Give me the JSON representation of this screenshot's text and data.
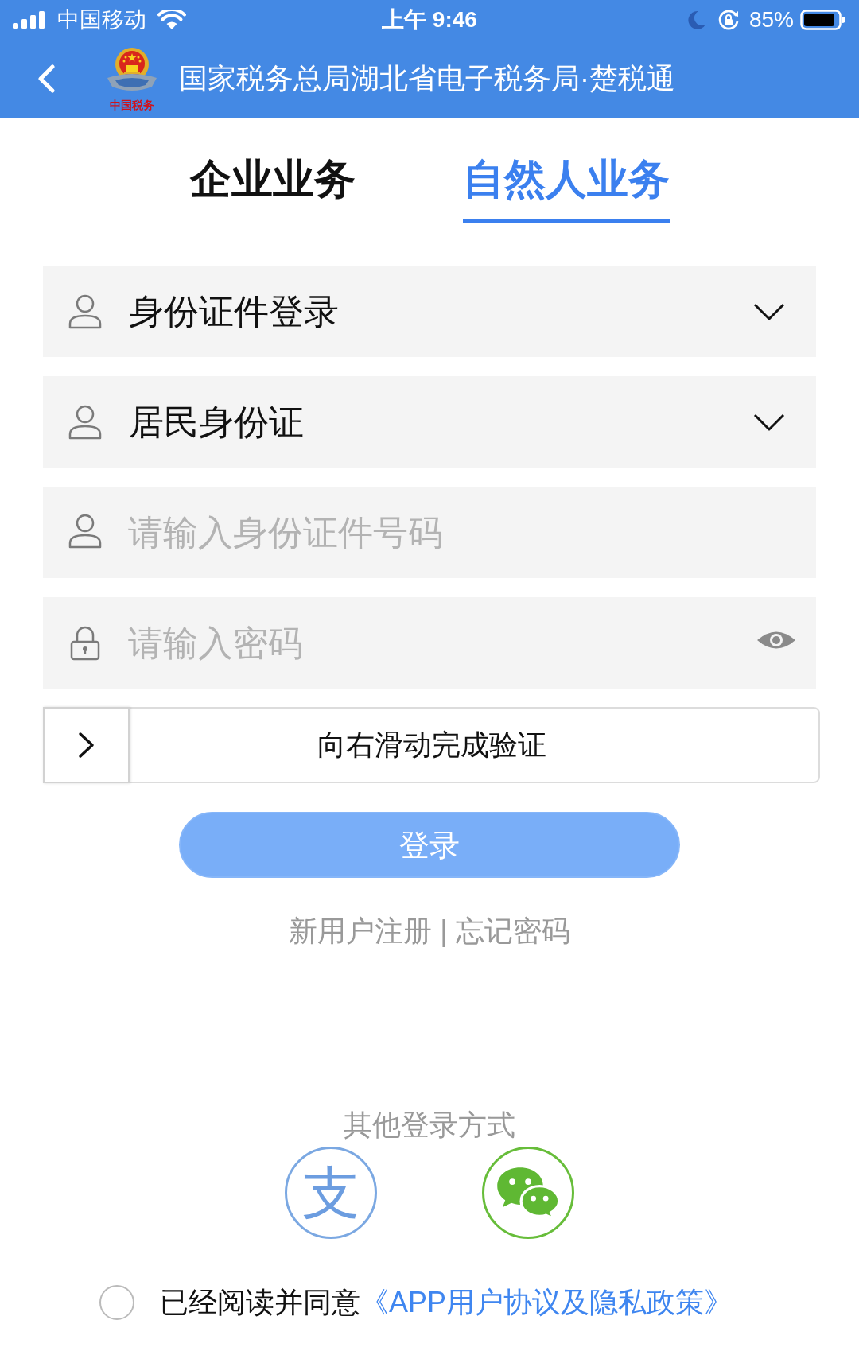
{
  "status_bar": {
    "carrier": "中国移动",
    "time": "上午 9:46",
    "battery": "85%"
  },
  "header": {
    "title": "国家税务总局湖北省电子税务局·楚税通",
    "logo_caption": "中国税务"
  },
  "tabs": [
    {
      "label": "企业业务",
      "selected": false
    },
    {
      "label": "自然人业务",
      "selected": true
    }
  ],
  "fields": [
    {
      "kind": "select",
      "value": "身份证件登录"
    },
    {
      "kind": "select",
      "value": "居民身份证"
    },
    {
      "kind": "text",
      "placeholder": "请输入身份证件号码"
    },
    {
      "kind": "password",
      "placeholder": "请输入密码"
    }
  ],
  "slider": {
    "hint": "向右滑动完成验证",
    "level": 0
  },
  "login_button": {
    "label": "登录"
  },
  "links": [
    {
      "label": "新用户注册"
    },
    {
      "label": "忘记密码"
    }
  ],
  "link_separator": "|",
  "other_login": {
    "title": "其他登录方式",
    "options": [
      {
        "kind": "glyph",
        "label": "支"
      },
      {
        "kind": "chat"
      }
    ]
  },
  "agreement": {
    "checked": false,
    "text": "已经阅读并同意",
    "link": "《APP用户协议及隐私政策》"
  }
}
